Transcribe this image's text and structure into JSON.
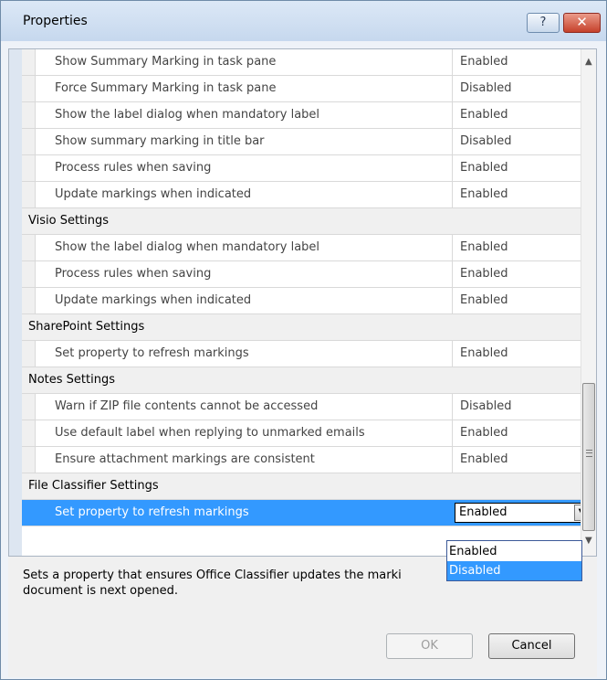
{
  "window": {
    "title": "Properties",
    "help_label": "?",
    "close_label": "✕"
  },
  "rows": [
    {
      "name": "Show Summary Marking in task pane",
      "value": "Enabled"
    },
    {
      "name": "Force Summary Marking in task pane",
      "value": "Disabled"
    },
    {
      "name": "Show the label dialog when mandatory label",
      "value": "Enabled"
    },
    {
      "name": "Show summary marking in title bar",
      "value": "Disabled"
    },
    {
      "name": "Process rules when saving",
      "value": "Enabled"
    },
    {
      "name": "Update markings when indicated",
      "value": "Enabled"
    },
    {
      "category": "Visio Settings"
    },
    {
      "name": "Show the label dialog when mandatory label",
      "value": "Enabled"
    },
    {
      "name": "Process rules when saving",
      "value": "Enabled"
    },
    {
      "name": "Update markings when indicated",
      "value": "Enabled"
    },
    {
      "category": "SharePoint Settings"
    },
    {
      "name": "Set property to refresh markings",
      "value": "Enabled"
    },
    {
      "category": "Notes Settings"
    },
    {
      "name": "Warn if ZIP file contents cannot be accessed",
      "value": "Disabled"
    },
    {
      "name": "Use default label when replying to unmarked emails",
      "value": "Enabled"
    },
    {
      "name": "Ensure attachment markings are consistent",
      "value": "Enabled"
    },
    {
      "category": "File Classifier Settings"
    },
    {
      "name": "Set property to refresh markings",
      "value": "Enabled",
      "selected": true
    }
  ],
  "dropdown": {
    "options": [
      "Enabled",
      "Disabled"
    ],
    "highlighted": "Disabled"
  },
  "description": "Sets a property that ensures Office Classifier updates the marking when the document is next opened.",
  "description_visible": "Sets a property that ensures Office Classifier updates the marki",
  "description_line2": "document is next opened.",
  "buttons": {
    "ok": "OK",
    "cancel": "Cancel"
  },
  "scroll_arrows": {
    "up": "▲",
    "down": "▼"
  },
  "combo_arrow": "▼"
}
